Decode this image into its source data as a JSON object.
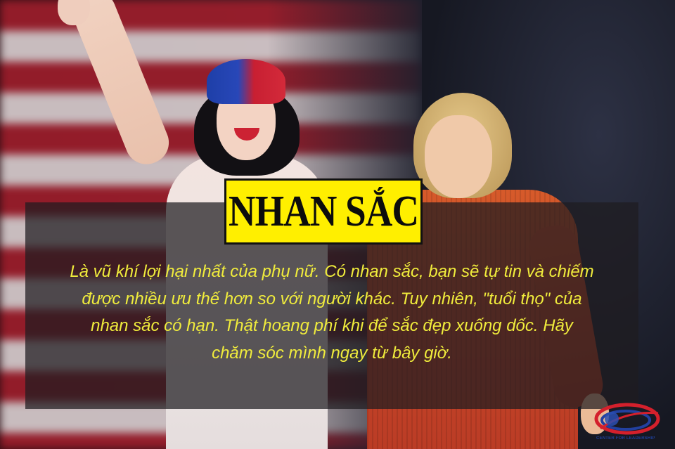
{
  "headline": "NHAN SẮC",
  "body_lines": [
    "Là vũ khí lợi hại nhất của phụ nữ. Có nhan sắc, bạn sẽ tự tin và chiếm",
    "được nhiều ưu thế hơn so với người khác. Tuy nhiên, \"tuổi thọ\" của",
    "nhan sắc có hạn. Thật hoang phí khi để sắc đẹp xuống dốc. Hãy",
    "chăm sóc mình ngay từ bây giờ."
  ],
  "logo": {
    "text": "CENTER FOR LEADERSHIP",
    "icon": "globe-swoosh-logo"
  },
  "colors": {
    "headline_bg": "#ffef00",
    "body_text": "#f0ec3c",
    "overlay": "#1e1c20"
  }
}
